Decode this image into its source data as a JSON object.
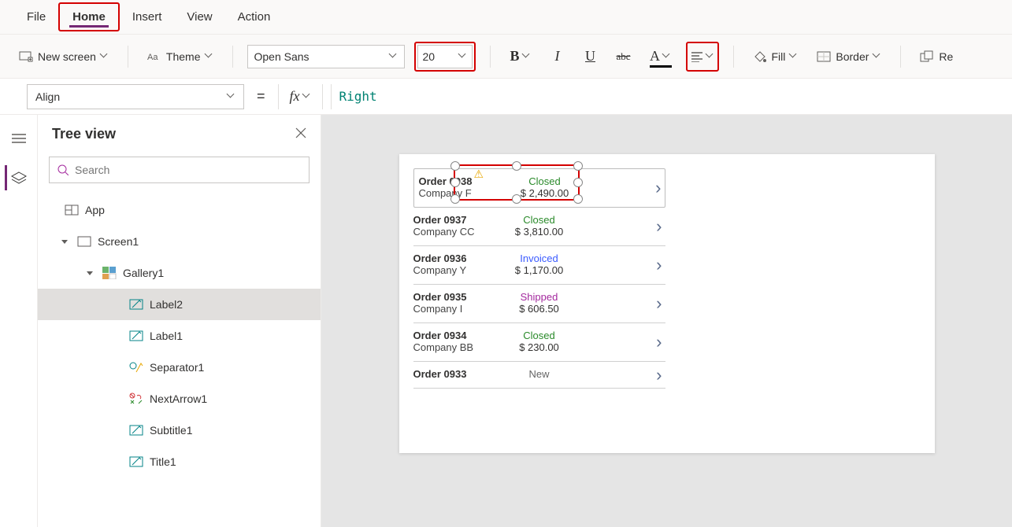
{
  "menu": {
    "file": "File",
    "home": "Home",
    "insert": "Insert",
    "view": "View",
    "action": "Action",
    "active": "home"
  },
  "ribbon": {
    "new_screen": "New screen",
    "theme": "Theme",
    "font_name": "Open Sans",
    "font_size": "20",
    "bold": "B",
    "italic": "I",
    "underline": "U",
    "strike": "abc",
    "fontcolor": "A",
    "fill": "Fill",
    "border": "Border",
    "reorder": "Re"
  },
  "fxbar": {
    "property": "Align",
    "value": "Right"
  },
  "treeview": {
    "title": "Tree view",
    "search_placeholder": "Search",
    "nodes": [
      {
        "label": "App",
        "indent": 0,
        "icon": "app",
        "expander": false
      },
      {
        "label": "Screen1",
        "indent": 1,
        "icon": "screen",
        "expander": true
      },
      {
        "label": "Gallery1",
        "indent": 2,
        "icon": "gallery",
        "expander": true
      },
      {
        "label": "Label2",
        "indent": 3,
        "icon": "label",
        "expander": false,
        "selected": true
      },
      {
        "label": "Label1",
        "indent": 3,
        "icon": "label",
        "expander": false
      },
      {
        "label": "Separator1",
        "indent": 3,
        "icon": "separator",
        "expander": false
      },
      {
        "label": "NextArrow1",
        "indent": 3,
        "icon": "nextarrow",
        "expander": false
      },
      {
        "label": "Subtitle1",
        "indent": 3,
        "icon": "label",
        "expander": false
      },
      {
        "label": "Title1",
        "indent": 3,
        "icon": "label",
        "expander": false
      }
    ]
  },
  "gallery": [
    {
      "order": "Order 0938",
      "company": "Company F",
      "status": "Closed",
      "price": "$ 2,490.00",
      "selected": true
    },
    {
      "order": "Order 0937",
      "company": "Company CC",
      "status": "Closed",
      "price": "$ 3,810.00"
    },
    {
      "order": "Order 0936",
      "company": "Company Y",
      "status": "Invoiced",
      "price": "$ 1,170.00"
    },
    {
      "order": "Order 0935",
      "company": "Company I",
      "status": "Shipped",
      "price": "$ 606.50"
    },
    {
      "order": "Order 0934",
      "company": "Company BB",
      "status": "Closed",
      "price": "$ 230.00"
    },
    {
      "order": "Order 0933",
      "company": "",
      "status": "New",
      "price": ""
    }
  ]
}
